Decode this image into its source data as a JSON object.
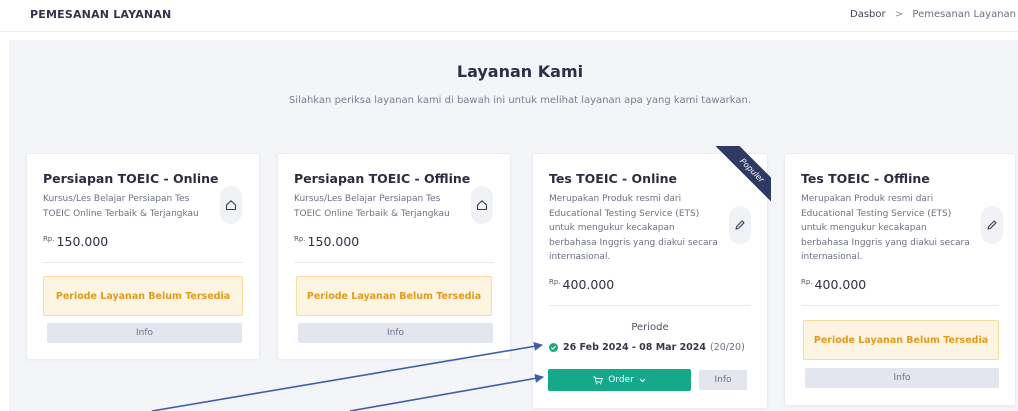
{
  "header": {
    "title": "PEMESANAN LAYANAN"
  },
  "breadcrumb": {
    "home": "Dasbor",
    "separator": ">",
    "current": "Pemesanan Layanan"
  },
  "section": {
    "heading": "Layanan Kami",
    "subtitle": "Silahkan periksa layanan kami di bawah ini untuk melihat layanan apa yang kami tawarkan."
  },
  "cards": [
    {
      "title": "Persiapan TOEIC - Online",
      "description": "Kursus/Les Belajar Persiapan Tes TOEIC Online Terbaik & Terjangkau",
      "currency": "Rp.",
      "price": "150.000",
      "icon": "home-icon",
      "notice": "Periode Layanan Belum Tersedia",
      "info_label": "Info"
    },
    {
      "title": "Persiapan TOEIC - Offline",
      "description": "Kursus/Les Belajar Persiapan Tes TOEIC Online Terbaik & Terjangkau",
      "currency": "Rp.",
      "price": "150.000",
      "icon": "home-icon",
      "notice": "Periode Layanan Belum Tersedia",
      "info_label": "Info"
    },
    {
      "title": "Tes TOEIC - Online",
      "description": "Merupakan Produk resmi dari Educational Testing Service (ETS) untuk mengukur kecakapan berbahasa Inggris yang diakui secara internasional.",
      "currency": "Rp.",
      "price": "400.000",
      "icon": "pencil-icon",
      "ribbon": "Populer",
      "periode_label": "Periode",
      "periode_dates": "26 Feb 2024 - 08 Mar 2024",
      "periode_quota": "(20/20)",
      "order_label": "Order",
      "info_label": "Info"
    },
    {
      "title": "Tes TOEIC - Offline",
      "description": "Merupakan Produk resmi dari Educational Testing Service (ETS) untuk mengukur kecakapan berbahasa Inggris yang diakui secara internasional.",
      "currency": "Rp.",
      "price": "400.000",
      "icon": "pencil-icon",
      "notice": "Periode Layanan Belum Tersedia",
      "info_label": "Info"
    }
  ],
  "colors": {
    "accent_green": "#16a88a",
    "warning_text": "#e49a1c",
    "warning_bg": "#fdf4e1",
    "ribbon": "#2e3a63",
    "annotation_arrow": "#3d5fa8"
  }
}
